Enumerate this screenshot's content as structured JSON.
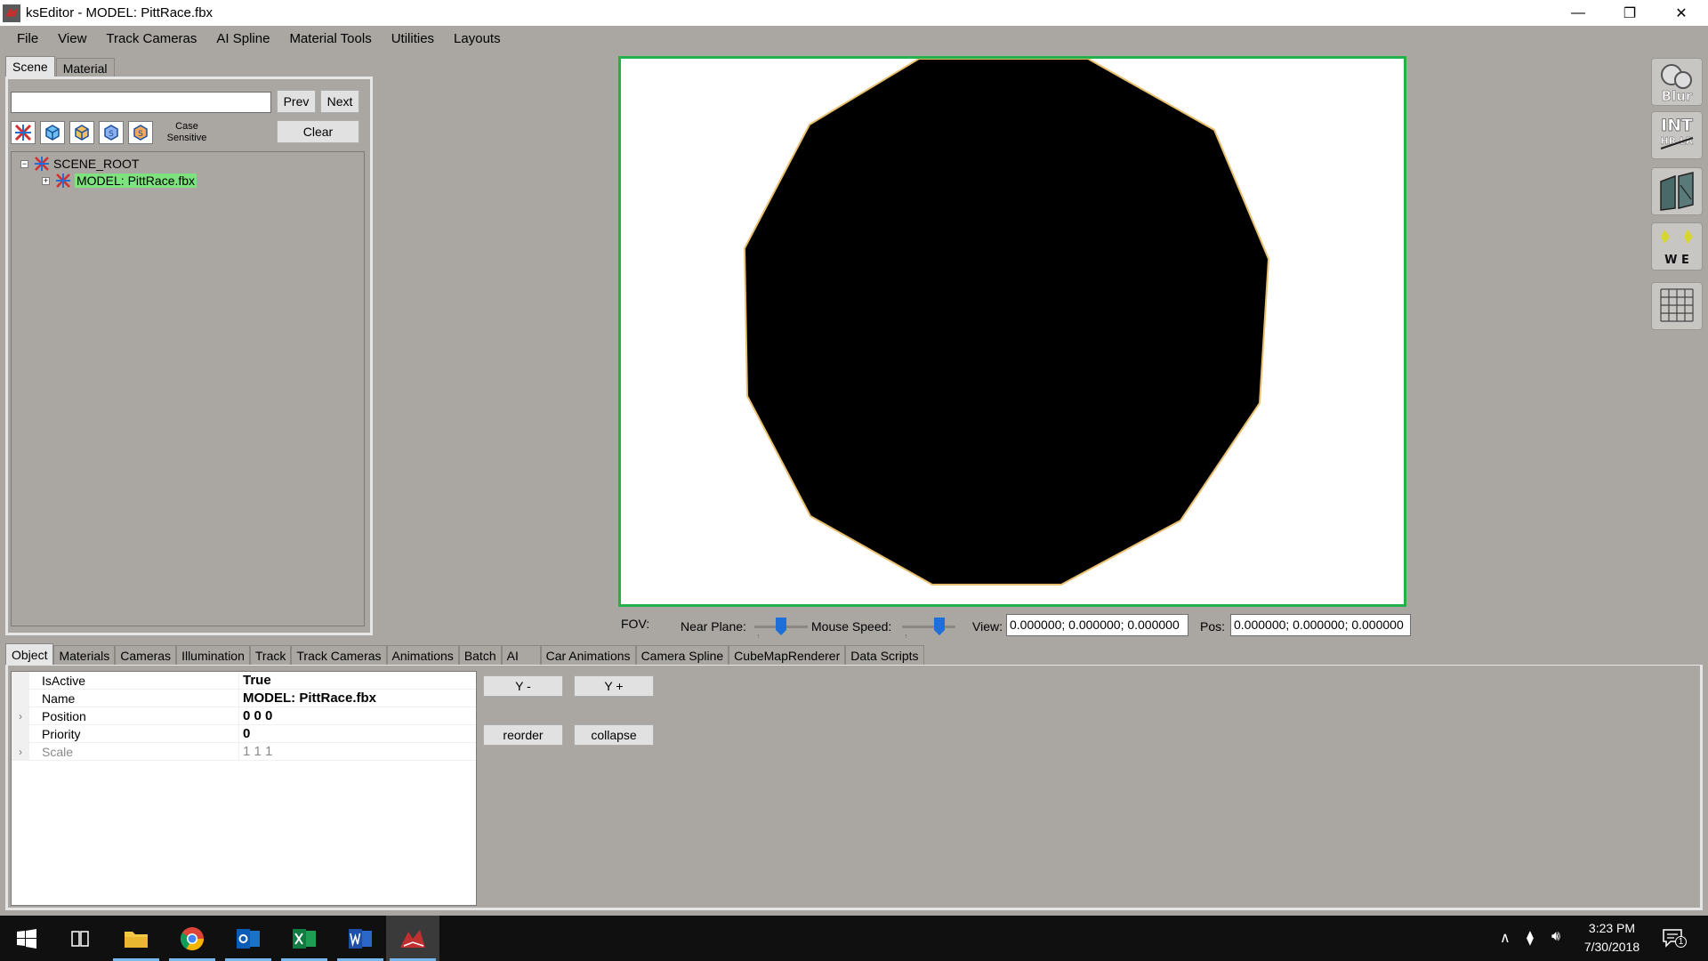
{
  "window": {
    "title": "ksEditor - MODEL: PittRace.fbx",
    "minimize_glyph": "—",
    "restore_glyph": "❐",
    "close_glyph": "✕"
  },
  "menu": [
    "File",
    "View",
    "Track Cameras",
    "AI Spline",
    "Material Tools",
    "Utilities",
    "Layouts"
  ],
  "left_panel": {
    "tabs": [
      "Scene",
      "Material"
    ],
    "active_tab": "Scene",
    "search": {
      "value": "",
      "placeholder": ""
    },
    "prev_label": "Prev",
    "next_label": "Next",
    "clear_label": "Clear",
    "case_sensitive_label": "Case Sensitive",
    "tree": {
      "root": {
        "label": "SCENE_ROOT",
        "expander": "−"
      },
      "child": {
        "label": "MODEL: PittRace.fbx",
        "expander": "+"
      }
    }
  },
  "viewport_controls": {
    "fov_label": "FOV:",
    "near_plane_label": "Near Plane:",
    "near_plane_level": 0.5,
    "mouse_speed_label": "Mouse Speed:",
    "mouse_speed_level": 0.75,
    "view_label": "View:",
    "view_value": "0.000000; 0.000000; 0.000000",
    "pos_label": "Pos:",
    "pos_value": "0.000000; 0.000000; 0.000000"
  },
  "right_toolbar": [
    {
      "name": "blur",
      "label": "Blur"
    },
    {
      "name": "int",
      "label": "INT",
      "sub": "HR LR"
    },
    {
      "name": "textures",
      "label": ""
    },
    {
      "name": "we",
      "label": "W E"
    },
    {
      "name": "grid",
      "label": ""
    }
  ],
  "bottom_tabs": [
    "Object",
    "Materials",
    "Cameras",
    "Illumination",
    "Track",
    "Track Cameras",
    "Animations",
    "Batch",
    "AI",
    "Car Animations",
    "Camera Spline",
    "CubeMapRenderer",
    "Data Scripts"
  ],
  "active_bottom_tab": "Object",
  "properties": [
    {
      "name": "IsActive",
      "value": "True",
      "expandable": false,
      "disabled": false
    },
    {
      "name": "Name",
      "value": "MODEL: PittRace.fbx",
      "expandable": false,
      "disabled": false
    },
    {
      "name": "Position",
      "value": "0 0 0",
      "expandable": true,
      "disabled": false
    },
    {
      "name": "Priority",
      "value": "0",
      "expandable": false,
      "disabled": false
    },
    {
      "name": "Scale",
      "value": "1 1 1",
      "expandable": true,
      "disabled": true
    }
  ],
  "object_buttons": {
    "y_minus": "Y -",
    "y_plus": "Y +",
    "reorder": "reorder",
    "collapse": "collapse"
  },
  "taskbar": {
    "time": "3:23 PM",
    "date": "7/30/2018",
    "notification_count": "1",
    "apps": [
      "Start",
      "Task View",
      "File Explorer",
      "Chrome",
      "Outlook",
      "Excel",
      "Word",
      "ksEditor"
    ]
  },
  "colors": {
    "viewport_border": "#22b14c",
    "selected_tree_item": "#7ee27e",
    "slider_thumb": "#1e6fd9",
    "panel_background": "#aaa6a2"
  }
}
